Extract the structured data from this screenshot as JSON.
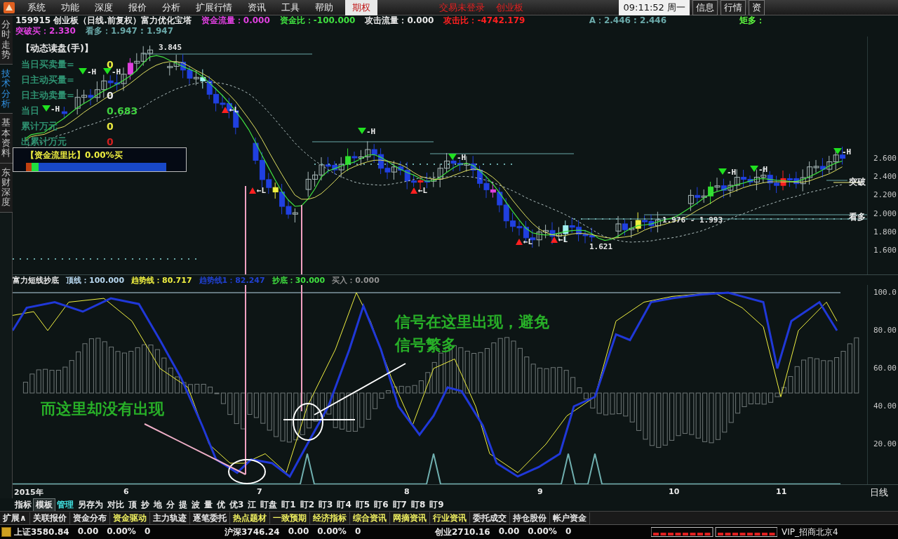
{
  "menu_bar": {
    "items": [
      "系统",
      "功能",
      "深度",
      "报价",
      "分析",
      "扩展行情",
      "资讯",
      "工具",
      "帮助"
    ],
    "special_tab": "期权",
    "login_status": "交易未登录",
    "market": "创业板",
    "clock": "09:11:52 周一",
    "buttons": [
      "信息",
      "行情",
      "资"
    ]
  },
  "side_tabs": [
    {
      "label": "分时走势",
      "selected": false
    },
    {
      "label": "技术分析",
      "selected": true
    },
    {
      "label": "基本资料",
      "selected": false
    },
    {
      "label": "东财深度",
      "selected": false
    }
  ],
  "quote_header": {
    "line1": [
      {
        "text": "159915 创业板（日线.前复权）富力优化宝塔",
        "color": "#e8e8e8"
      },
      {
        "text": "资金流量：0.000",
        "color": "#e040e0"
      },
      {
        "text": "资金比：-100.000",
        "color": "#40e040"
      },
      {
        "text": "攻击流量：0.000",
        "color": "#e8e8e8"
      },
      {
        "text": "攻击比：-4742.179",
        "color": "#ff2020"
      },
      {
        "text": "A：2.446 : 2.446",
        "color": "#6aa8a8"
      },
      {
        "text": "矩多：",
        "color": "#60ff40"
      }
    ],
    "line2": [
      {
        "text": "突破买：2.330",
        "color": "#e040e0"
      },
      {
        "text": "看多：1.947 : 1.947",
        "color": "#6aa8a8"
      }
    ]
  },
  "price_chart": {
    "panel": {
      "title": "【动态读盘(手)】",
      "rows": [
        {
          "label": "当日买卖量=",
          "value": "0",
          "color": "#e8e840"
        },
        {
          "label": "日主动买量="
        },
        {
          "label": "日主动卖量=",
          "value": "0",
          "color": "#e8e8e8"
        },
        {
          "label": "当日",
          "value": "0.683",
          "color": "#40d040"
        },
        {
          "label": "累计万元",
          "value": "0",
          "color": "#e8e840"
        },
        {
          "label": "出累计万元",
          "value": "0",
          "color": "#d02020"
        }
      ]
    },
    "fund_flow": {
      "label": "【资金流里比】0.00%买"
    },
    "signals": [
      {
        "kind": "high",
        "label": "-H"
      },
      {
        "kind": "high",
        "label": "-H"
      },
      {
        "kind": "high",
        "label": "-H"
      },
      {
        "kind": "high",
        "label": "-H"
      },
      {
        "kind": "high",
        "label": "-H"
      },
      {
        "kind": "high",
        "label": "-H"
      },
      {
        "kind": "high",
        "label": "-H"
      },
      {
        "kind": "high",
        "label": "-H"
      },
      {
        "kind": "low",
        "label": "←L"
      },
      {
        "kind": "low",
        "label": "←L"
      },
      {
        "kind": "low",
        "label": "←L"
      },
      {
        "kind": "low",
        "label": "←L"
      },
      {
        "kind": "low",
        "label": "←L"
      }
    ],
    "price_labels": [
      "3.845",
      "1.621",
      "1.976 - 1.993"
    ],
    "line_labels": [
      "突破",
      "看多"
    ],
    "axis": [
      "2.600",
      "2.400",
      "2.200",
      "2.000",
      "1.800",
      "1.600"
    ]
  },
  "indicator": {
    "header": [
      {
        "text": "富力短线抄底",
        "color": "#e8e8e8"
      },
      {
        "text": "顶线：100.000",
        "color": "#b8d8f0"
      },
      {
        "text": "趋势线：80.717",
        "color": "#f0f040"
      },
      {
        "text": "趋势线1：82.247",
        "color": "#2040d0"
      },
      {
        "text": "抄底：30.000",
        "color": "#40e040"
      },
      {
        "text": "买入：0.000",
        "color": "#909090"
      }
    ],
    "axis": [
      "100.0",
      "80.00",
      "60.00",
      "40.00",
      "20.00"
    ],
    "annotations": [
      "信号在这里出现，避免信号繁多",
      "而这里却没有出现"
    ]
  },
  "x_axis": {
    "labels": [
      "2015年",
      "6",
      "7",
      "8",
      "9",
      "10",
      "11"
    ],
    "period": "日线"
  },
  "toolbar": [
    {
      "label": "指标",
      "selected": false,
      "color": "#e8e8e8"
    },
    {
      "label": "模板",
      "selected": true,
      "color": "#e8e8e8"
    },
    {
      "label": "管理",
      "selected": false,
      "color": "#40e0e0"
    },
    {
      "label": "另存为",
      "selected": false,
      "color": "#e8e8e8"
    },
    {
      "label": "对比",
      "selected": false,
      "color": "#e8e8e8"
    },
    {
      "label": "顶",
      "selected": false,
      "color": "#e8e8e8"
    },
    {
      "label": "抄",
      "selected": false,
      "color": "#e8e8e8"
    },
    {
      "label": "地",
      "selected": false,
      "color": "#e8e8e8"
    },
    {
      "label": "分",
      "selected": false,
      "color": "#e8e8e8"
    },
    {
      "label": "提",
      "selected": false,
      "color": "#e8e8e8"
    },
    {
      "label": "波",
      "selected": false,
      "color": "#e8e8e8"
    },
    {
      "label": "量",
      "selected": false,
      "color": "#e8e8e8"
    },
    {
      "label": "优",
      "selected": false,
      "color": "#e8e8e8"
    },
    {
      "label": "优3",
      "selected": false,
      "color": "#e8e8e8"
    },
    {
      "label": "江",
      "selected": false,
      "color": "#e8e8e8"
    },
    {
      "label": "盯盘",
      "selected": false,
      "color": "#e8e8e8"
    },
    {
      "label": "盯1",
      "selected": false,
      "color": "#e8e8e8"
    },
    {
      "label": "盯2",
      "selected": false,
      "color": "#e8e8e8"
    },
    {
      "label": "盯3",
      "selected": false,
      "color": "#e8e8e8"
    },
    {
      "label": "盯4",
      "selected": false,
      "color": "#e8e8e8"
    },
    {
      "label": "盯5",
      "selected": false,
      "color": "#e8e8e8"
    },
    {
      "label": "盯6",
      "selected": false,
      "color": "#e8e8e8"
    },
    {
      "label": "盯7",
      "selected": false,
      "color": "#e8e8e8"
    },
    {
      "label": "盯8",
      "selected": false,
      "color": "#e8e8e8"
    },
    {
      "label": "盯9",
      "selected": false,
      "color": "#e8e8e8"
    }
  ],
  "tabs": [
    {
      "label": "扩展∧",
      "color": "#e8e8e8"
    },
    {
      "label": "关联报价",
      "color": "#e8e8e8"
    },
    {
      "label": "资金分布",
      "color": "#e8e8e8"
    },
    {
      "label": "资金驱动",
      "color": "#f0f060"
    },
    {
      "label": "主力轨迹",
      "color": "#e8e8e8"
    },
    {
      "label": "逐笔委托",
      "color": "#e8e8e8"
    },
    {
      "label": "热点题材",
      "color": "#f0f060"
    },
    {
      "label": "一致预期",
      "color": "#f0f060"
    },
    {
      "label": "经济指标",
      "color": "#f0f060"
    },
    {
      "label": "综合资讯",
      "color": "#f0f060"
    },
    {
      "label": "网摘资讯",
      "color": "#f0f060"
    },
    {
      "label": "行业资讯",
      "color": "#f0f060"
    },
    {
      "label": "委托成交",
      "color": "#e8e8e8"
    },
    {
      "label": "持仓股份",
      "color": "#e8e8e8"
    },
    {
      "label": "帐户资金",
      "color": "#e8e8e8"
    }
  ],
  "status_bar": {
    "indices": [
      {
        "name": "上证",
        "value": "3580.84",
        "change": "0.00",
        "percent": "0.00%",
        "volume": "0"
      },
      {
        "name": "沪深",
        "value": "3746.24",
        "change": "0.00",
        "percent": "0.00%",
        "volume": "0"
      },
      {
        "name": "创业",
        "value": "2710.16",
        "change": "0.00",
        "percent": "0.00%",
        "volume": "0"
      }
    ],
    "server": "VIP_招商北京4"
  }
}
